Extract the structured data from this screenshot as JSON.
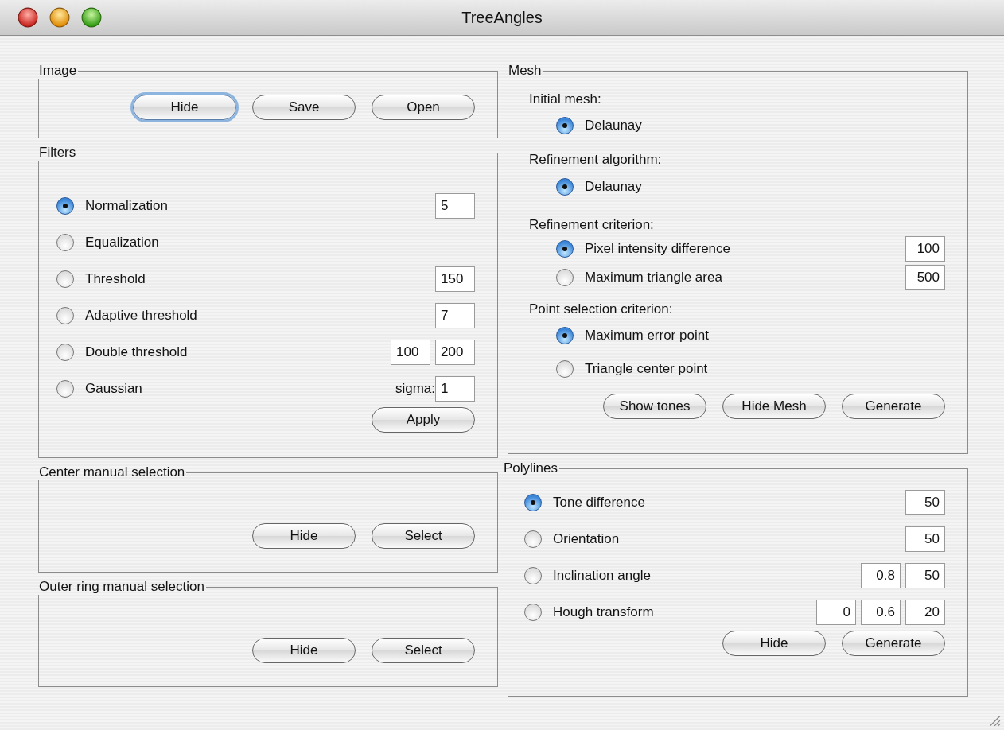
{
  "window": {
    "title": "TreeAngles"
  },
  "left": [
    {
      "title": "Image",
      "buttons": [
        {
          "label": "Hide",
          "focused": true
        },
        {
          "label": "Save",
          "focused": false
        },
        {
          "label": "Open",
          "focused": false
        }
      ]
    },
    {
      "title": "Filters",
      "options": [
        {
          "label": "Normalization",
          "selected": true,
          "fields": [
            "5"
          ]
        },
        {
          "label": "Equalization",
          "selected": false
        },
        {
          "label": "Threshold",
          "selected": false,
          "fields": [
            "150"
          ]
        },
        {
          "label": "Adaptive threshold",
          "selected": false,
          "fields": [
            "7"
          ]
        },
        {
          "label": "Double threshold",
          "selected": false,
          "fields": [
            "100",
            "200"
          ]
        },
        {
          "label": "Gaussian",
          "selected": false,
          "field_label": "sigma:",
          "fields": [
            "1"
          ]
        }
      ],
      "buttons": [
        {
          "label": "Apply",
          "focused": false
        }
      ]
    },
    {
      "title": "Center manual selection",
      "buttons": [
        {
          "label": "Hide",
          "focused": false
        },
        {
          "label": "Select",
          "focused": false
        }
      ]
    },
    {
      "title": "Outer ring manual selection",
      "buttons": [
        {
          "label": "Hide",
          "focused": false
        },
        {
          "label": "Select",
          "focused": false
        }
      ]
    }
  ],
  "right": [
    {
      "title": "Mesh",
      "sections": [
        {
          "heading": "Initial mesh:",
          "options": [
            {
              "label": "Delaunay",
              "selected": true
            }
          ]
        },
        {
          "heading": "Refinement algorithm:",
          "options": [
            {
              "label": "Delaunay",
              "selected": true
            }
          ]
        },
        {
          "heading": "Refinement criterion:",
          "options": [
            {
              "label": "Pixel intensity difference",
              "selected": true,
              "fields": [
                "100"
              ]
            },
            {
              "label": "Maximum triangle area",
              "selected": false,
              "fields": [
                "500"
              ]
            }
          ]
        },
        {
          "heading": "Point selection criterion:",
          "options": [
            {
              "label": "Maximum error point",
              "selected": true
            },
            {
              "label": "Triangle center point",
              "selected": false
            }
          ]
        }
      ],
      "buttons": [
        {
          "label": "Show tones",
          "focused": false
        },
        {
          "label": "Hide Mesh",
          "focused": false
        },
        {
          "label": "Generate",
          "focused": false
        }
      ]
    },
    {
      "title": "Polylines",
      "options": [
        {
          "label": "Tone difference",
          "selected": true,
          "fields": [
            "50"
          ]
        },
        {
          "label": "Orientation",
          "selected": false,
          "fields": [
            "50"
          ]
        },
        {
          "label": "Inclination angle",
          "selected": false,
          "fields": [
            "0.8",
            "50"
          ]
        },
        {
          "label": "Hough transform",
          "selected": false,
          "fields": [
            "0",
            "0.6",
            "20"
          ]
        }
      ],
      "buttons": [
        {
          "label": "Hide",
          "focused": false
        },
        {
          "label": "Generate",
          "focused": false
        }
      ]
    }
  ]
}
